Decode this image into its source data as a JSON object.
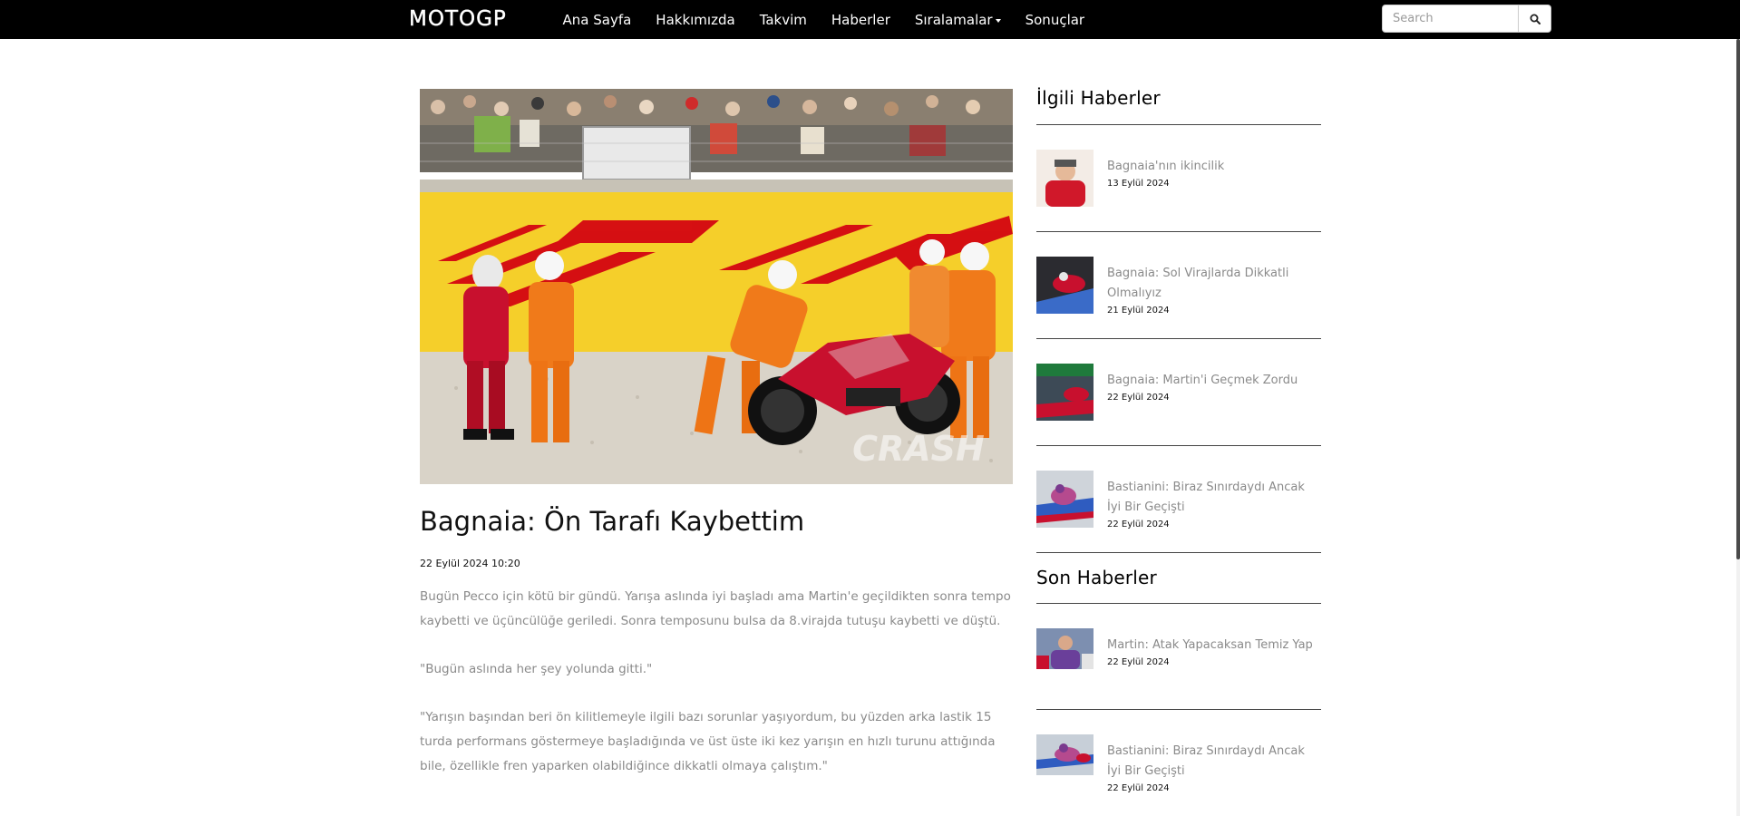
{
  "navbar": {
    "brand": "MOTOGP",
    "items": [
      {
        "label": "Ana Sayfa"
      },
      {
        "label": "Hakkımızda"
      },
      {
        "label": "Takvim"
      },
      {
        "label": "Haberler"
      },
      {
        "label": "Sıralamalar",
        "dropdown": true
      },
      {
        "label": "Sonuçlar"
      }
    ],
    "search": {
      "placeholder": "Search",
      "button_icon": "search-icon"
    }
  },
  "article": {
    "image_watermark": "CRASH",
    "title": "Bagnaia: Ön Tarafı Kaybettim",
    "date": "22 Eylül 2024 10:20",
    "paragraphs": [
      "Bugün Pecco için kötü bir gündü. Yarışa aslında iyi başladı ama Martin'e geçildikten sonra tempo kaybetti ve üçüncülüğe geriledi. Sonra temposunu bulsa da 8.virajda tutuşu kaybetti ve düştü.",
      "\"Bugün aslında her şey yolunda gitti.\"",
      "\"Yarışın başından beri ön kilitlemeyle ilgili bazı sorunlar yaşıyordum, bu yüzden arka lastik 15 turda performans göstermeye başladığında ve üst üste iki kez yarışın en hızlı turunu attığında bile, özellikle fren yaparken olabildiğince dikkatli olmaya çalıştım.\""
    ]
  },
  "sidebar": {
    "related_heading": "İlgili Haberler",
    "related": [
      {
        "title": "Bagnaia'nın ikincilik",
        "date": "13 Eylül 2024"
      },
      {
        "title": "Bagnaia: Sol Virajlarda Dikkatli Olmalıyız",
        "date": "21 Eylül 2024"
      },
      {
        "title": "Bagnaia: Martin'i Geçmek Zordu",
        "date": "22 Eylül 2024"
      },
      {
        "title": "Bastianini: Biraz Sınırdaydı Ancak İyi Bir Geçişti",
        "date": "22 Eylül 2024"
      }
    ],
    "latest_heading": "Son Haberler",
    "latest": [
      {
        "title": "Martin: Atak Yapacaksan Temiz Yap",
        "date": "22 Eylül 2024"
      },
      {
        "title": "Bastianini: Biraz Sınırdaydı Ancak İyi Bir Geçişti",
        "date": "22 Eylül 2024"
      }
    ]
  },
  "colors": {
    "navbar_bg": "#000000",
    "link_gray": "#8a8a8a",
    "dhl_yellow": "#f5cf2a",
    "dhl_red": "#d40511",
    "marshal_orange": "#f07a1a"
  }
}
